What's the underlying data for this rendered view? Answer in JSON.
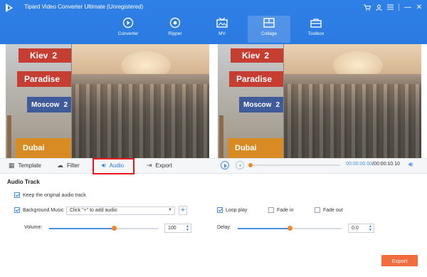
{
  "app": {
    "title": "Tipard Video Converter Ultimate (Unregistered)"
  },
  "window_controls": {
    "icons": [
      "cart-icon",
      "user-icon",
      "menu-icon",
      "minimize-icon",
      "close-icon"
    ],
    "min": "—",
    "close": "✕"
  },
  "nav": {
    "items": [
      {
        "label": "Converter",
        "icon": "converter-icon"
      },
      {
        "label": "Ripper",
        "icon": "ripper-icon"
      },
      {
        "label": "MV",
        "icon": "mv-icon"
      },
      {
        "label": "Collage",
        "icon": "collage-icon",
        "active": true
      },
      {
        "label": "Toolbox",
        "icon": "toolbox-icon"
      }
    ]
  },
  "preview": {
    "signs": [
      "Kiev",
      "Paradise",
      "Moscow",
      "Dubai"
    ],
    "sign_suffixes": [
      "2",
      "2"
    ]
  },
  "tabs": [
    {
      "label": "Template",
      "icon": "template-icon"
    },
    {
      "label": "Filter",
      "icon": "filter-icon"
    },
    {
      "label": "Audio",
      "icon": "audio-icon",
      "active": true
    },
    {
      "label": "Export",
      "icon": "export-icon"
    }
  ],
  "player": {
    "current": "00:00:00.00",
    "total": "/00:00:10.10",
    "progress": 0.0
  },
  "audio": {
    "section_title": "Audio Track",
    "keep_original": {
      "label": "Keep the original audio track",
      "checked": true
    },
    "background_music": {
      "label": "Background Music",
      "checked": true,
      "select_value": "Click \"+\" to add audio",
      "add_label": "+"
    },
    "volume": {
      "label": "Volume:",
      "value": "100",
      "level": 0.6
    },
    "loop_play": {
      "label": "Loop play",
      "checked": true
    },
    "fade_in": {
      "label": "Fade in",
      "checked": false
    },
    "fade_out": {
      "label": "Fade out",
      "checked": false
    },
    "delay": {
      "label": "Delay:",
      "value": "0.0",
      "level": 0.5
    }
  },
  "export_button": {
    "label": "Export"
  },
  "colors": {
    "header": "#2a7ae2",
    "accent": "#4a90e2",
    "export": "#f26d3d",
    "highlight": "#e8191c",
    "knob": "#f08a24"
  }
}
